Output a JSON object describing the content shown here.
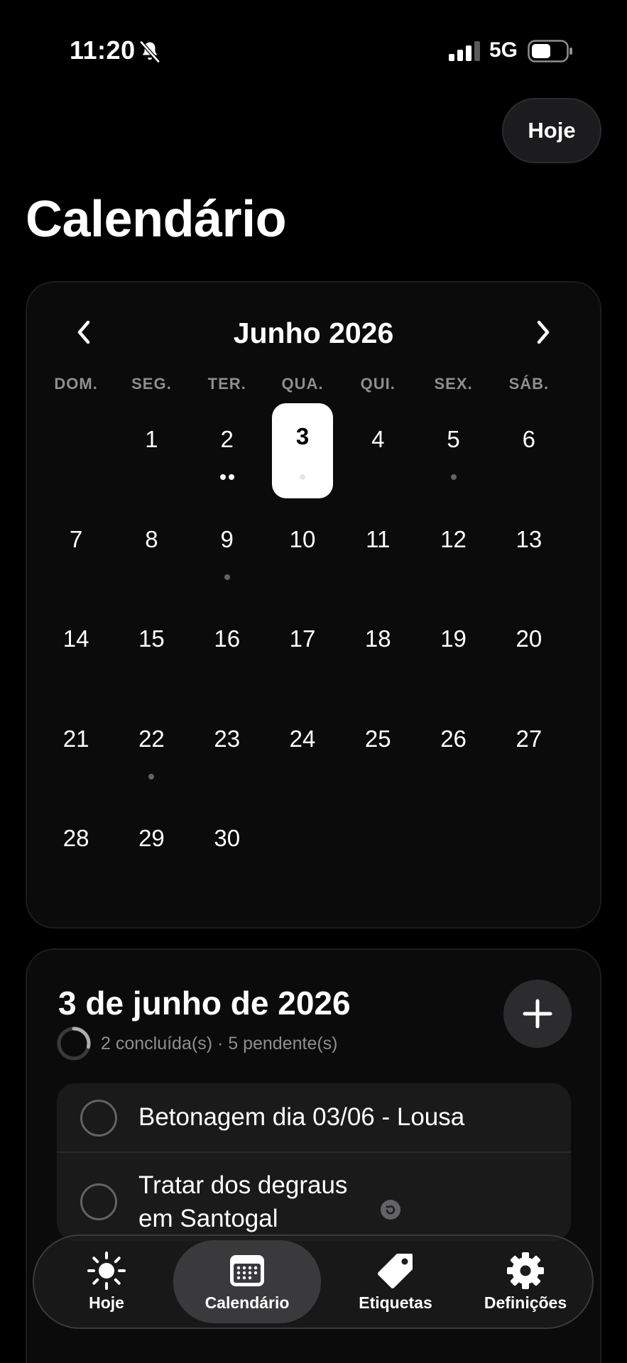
{
  "status_bar": {
    "time": "11:20",
    "network": "5G"
  },
  "header": {
    "today_button": "Hoje",
    "title": "Calendário"
  },
  "calendar": {
    "month_label": "Junho 2026",
    "weekdays": [
      "DOM.",
      "SEG.",
      "TER.",
      "QUA.",
      "QUI.",
      "SEX.",
      "SÁB."
    ],
    "start_offset": 1,
    "days_in_month": 30,
    "selected_day": 3,
    "marked_days": {
      "2": 2,
      "3": 1,
      "5": 1,
      "9": 1,
      "22": 1
    }
  },
  "day_detail": {
    "title": "3 de junho de 2026",
    "summary": "2 concluída(s) · 5 pendente(s)",
    "done": 2,
    "pending": 5,
    "tasks": [
      {
        "text": "Betonagem dia 03/06 - Lousa"
      },
      {
        "text": "Tratar dos degraus em Santogal"
      }
    ]
  },
  "tab_bar": {
    "items": [
      {
        "label": "Hoje",
        "icon": "sun-icon"
      },
      {
        "label": "Calendário",
        "icon": "calendar-icon"
      },
      {
        "label": "Etiquetas",
        "icon": "tag-icon"
      },
      {
        "label": "Definições",
        "icon": "gear-icon"
      }
    ],
    "active": 1
  },
  "colors": {
    "background": "#000000",
    "card": "#0b0b0b",
    "muted": "#8e8e93"
  }
}
